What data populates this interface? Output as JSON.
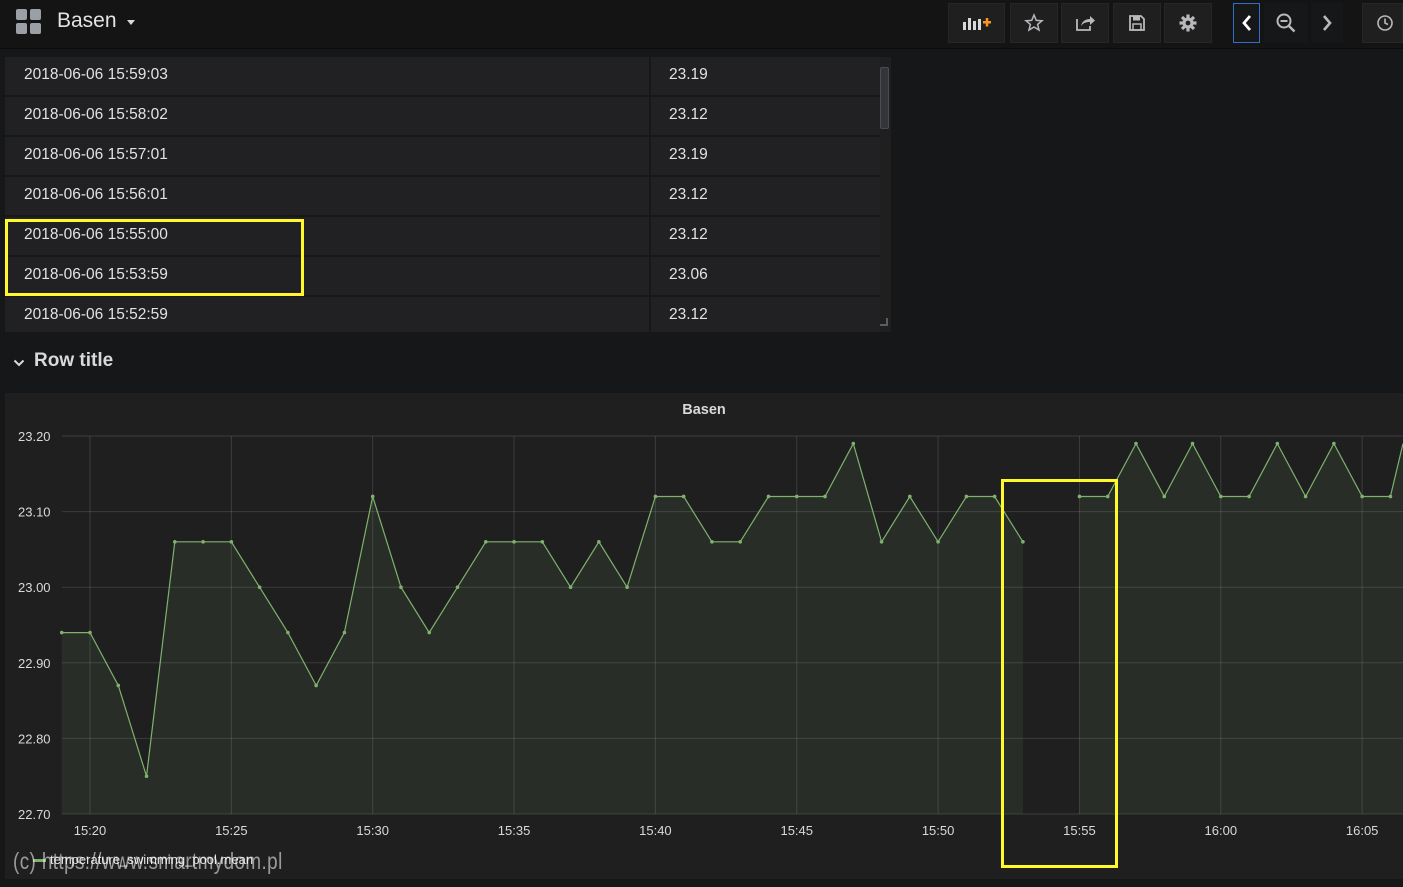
{
  "navbar": {
    "title": "Basen",
    "buttons": [
      {
        "name": "add-panel-button",
        "icon": "add-panel-icon"
      },
      {
        "name": "star-button",
        "icon": "star-icon"
      },
      {
        "name": "share-button",
        "icon": "share-icon"
      },
      {
        "name": "save-button",
        "icon": "save-icon"
      },
      {
        "name": "settings-button",
        "icon": "gear-icon"
      },
      {
        "name": "time-back-button",
        "icon": "chevron-left-icon"
      },
      {
        "name": "zoom-out-button",
        "icon": "zoom-out-icon"
      },
      {
        "name": "time-forward-button",
        "icon": "chevron-right-icon"
      },
      {
        "name": "time-picker-button",
        "icon": "clock-icon"
      }
    ]
  },
  "table": {
    "rows": [
      {
        "time": "2018-06-06 15:59:03",
        "value": "23.19"
      },
      {
        "time": "2018-06-06 15:58:02",
        "value": "23.12"
      },
      {
        "time": "2018-06-06 15:57:01",
        "value": "23.19"
      },
      {
        "time": "2018-06-06 15:56:01",
        "value": "23.12"
      },
      {
        "time": "2018-06-06 15:55:00",
        "value": "23.12"
      },
      {
        "time": "2018-06-06 15:53:59",
        "value": "23.06"
      },
      {
        "time": "2018-06-06 15:52:59",
        "value": "23.12"
      }
    ]
  },
  "row": {
    "title": "Row title"
  },
  "chart_data": {
    "type": "line",
    "title": "Basen",
    "xlabel": "",
    "ylabel": "",
    "ylim": [
      22.7,
      23.2
    ],
    "y_ticks": [
      "23.20",
      "23.10",
      "23.00",
      "22.90",
      "22.80",
      "22.70"
    ],
    "x_ticks": [
      "15:20",
      "15:25",
      "15:30",
      "15:35",
      "15:40",
      "15:45",
      "15:50",
      "15:55",
      "16:00",
      "16:05"
    ],
    "grid": true,
    "fill": true,
    "legend_placement": "bottom-left",
    "series": [
      {
        "name": "temperature_swimming_pool.mean",
        "color": "#7eb26d",
        "segments": [
          {
            "x": [
              "15:19",
              "15:20",
              "15:21",
              "15:22",
              "15:23",
              "15:24",
              "15:25",
              "15:26",
              "15:27",
              "15:28",
              "15:29",
              "15:30",
              "15:31",
              "15:32",
              "15:33",
              "15:34",
              "15:35",
              "15:36",
              "15:37",
              "15:38",
              "15:39",
              "15:40",
              "15:41",
              "15:42",
              "15:43",
              "15:44",
              "15:45",
              "15:46",
              "15:47",
              "15:48",
              "15:49",
              "15:50",
              "15:51",
              "15:52",
              "15:53"
            ],
            "y": [
              22.94,
              22.94,
              22.87,
              22.75,
              23.06,
              23.06,
              23.06,
              23.0,
              22.94,
              22.87,
              22.94,
              23.12,
              23.0,
              22.94,
              23.0,
              23.06,
              23.06,
              23.06,
              23.0,
              23.06,
              23.0,
              23.12,
              23.12,
              23.06,
              23.06,
              23.12,
              23.12,
              23.12,
              23.19,
              23.06,
              23.12,
              23.06,
              23.12,
              23.12,
              23.06
            ]
          },
          {
            "x": [
              "15:55",
              "15:56",
              "15:57",
              "15:58",
              "15:59",
              "16:00",
              "16:01",
              "16:02",
              "16:03",
              "16:04",
              "16:05",
              "16:06",
              "16:07"
            ],
            "y": [
              23.12,
              23.12,
              23.19,
              23.12,
              23.19,
              23.12,
              23.12,
              23.19,
              23.12,
              23.19,
              23.12,
              23.12,
              23.19
            ]
          }
        ]
      }
    ]
  },
  "watermark": "(c) https://www.smartmydom.pl",
  "colors": {
    "highlight": "#fff82b",
    "series": "#7eb26d",
    "panel_bg": "#1f1f20",
    "page_bg": "#161719"
  }
}
